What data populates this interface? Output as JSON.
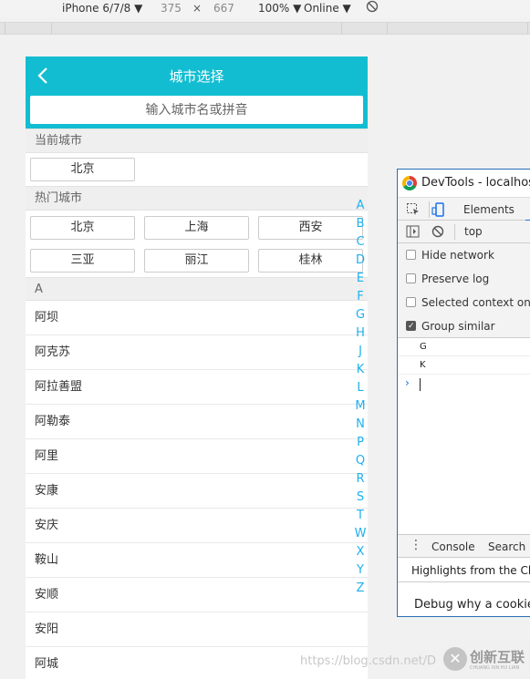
{
  "device_toolbar": {
    "device": "iPhone 6/7/8 ▼",
    "width": "375",
    "times": "×",
    "height": "667",
    "zoom": "100% ▼",
    "network": "Online ▼"
  },
  "app": {
    "title": "城市选择",
    "search_placeholder": "输入城市名或拼音",
    "current_city_label": "当前城市",
    "current_city": "北京",
    "hot_cities_label": "热门城市",
    "hot_cities": [
      "北京",
      "上海",
      "西安",
      "三亚",
      "丽江",
      "桂林"
    ],
    "group_letter": "A",
    "cities": [
      "阿坝",
      "阿克苏",
      "阿拉善盟",
      "阿勒泰",
      "阿里",
      "安康",
      "安庆",
      "鞍山",
      "安顺",
      "安阳",
      "阿城"
    ],
    "index_letters": [
      "A",
      "B",
      "C",
      "D",
      "E",
      "F",
      "G",
      "H",
      "J",
      "K",
      "L",
      "M",
      "N",
      "P",
      "Q",
      "R",
      "S",
      "T",
      "W",
      "X",
      "Y",
      "Z"
    ]
  },
  "devtools": {
    "title": "DevTools - localhost:",
    "tab_elements": "Elements",
    "context": "top",
    "options": [
      {
        "label": "Hide network",
        "checked": false
      },
      {
        "label": "Preserve log",
        "checked": false
      },
      {
        "label": "Selected context only",
        "checked": false
      },
      {
        "label": "Group similar",
        "checked": true
      }
    ],
    "logs": [
      "G",
      "K"
    ],
    "prompt": "›",
    "drawer_tabs": {
      "console": "Console",
      "search": "Search"
    },
    "highlights": "Highlights from the Chro",
    "debug_text": "Debug why a cookie"
  },
  "watermark": "https://blog.csdn.net/D",
  "brand": {
    "logo": "✕",
    "name": "创新互联",
    "sub": "CHUANG XIN HU LIAN"
  },
  "colors": {
    "header": "#13bdd1",
    "index_letter": "#1eb0ee",
    "devtools_border": "#2a6fb5"
  }
}
